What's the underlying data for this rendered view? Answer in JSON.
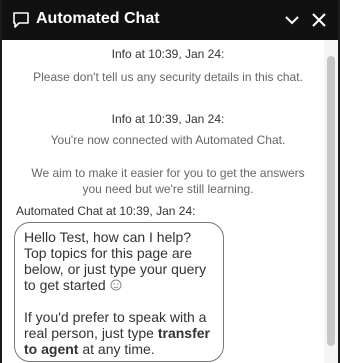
{
  "header": {
    "title": "Automated Chat"
  },
  "messages": {
    "system1": {
      "meta": "Info at 10:39, Jan 24:",
      "text": "Please don't tell us any security details in this chat."
    },
    "system2": {
      "meta": "Info at 10:39, Jan 24:",
      "text": "You're now connected with Automated Chat.",
      "text2": "We aim to make it easier for you to get the answers you need but we're still learning."
    },
    "bot": {
      "sender": "Automated Chat at 10:39, Jan 24:",
      "p1": "Hello Test, how can I help? Top topics for this page are below, or just type your query to get started",
      "p2_before": "If you'd prefer to speak with a real person, just type ",
      "p2_bold": "transfer to agent",
      "p2_after": " at any time."
    }
  },
  "colors": {
    "header_bg": "#111111",
    "header_text": "#ffffff",
    "bubble_border": "#777777"
  },
  "icons": {
    "chat": "chat-bubble-icon",
    "minimize": "chevron-down-icon",
    "close": "close-icon",
    "thinking": "thinking-face-icon"
  }
}
